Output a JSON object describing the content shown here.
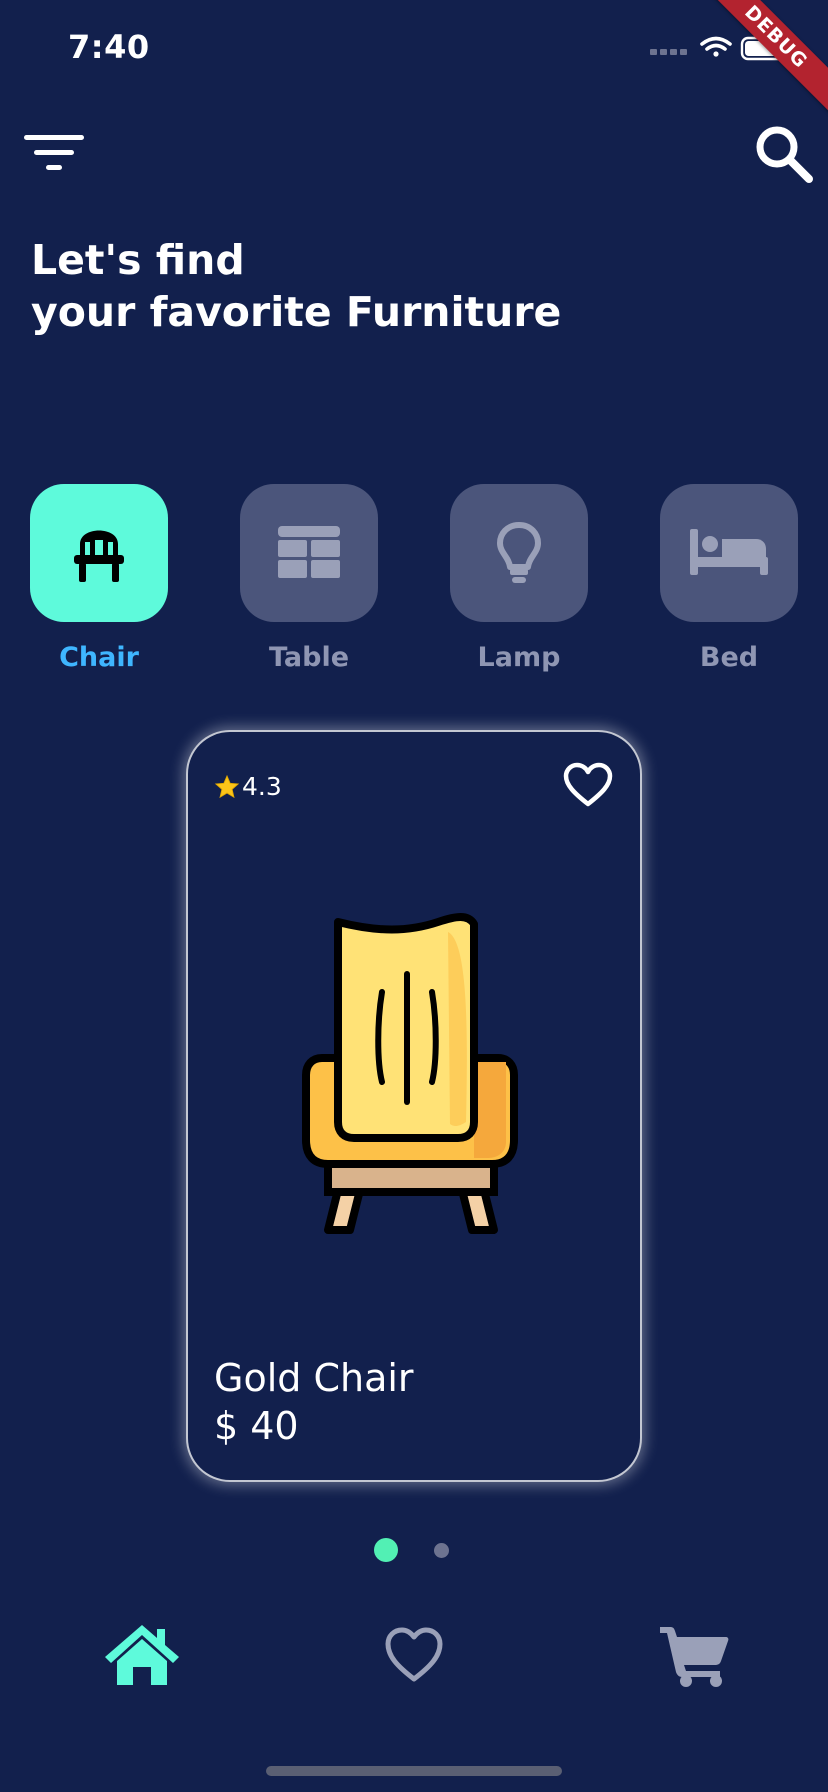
{
  "status_bar": {
    "time": "7:40",
    "debug_label": "DEBUG"
  },
  "header": {
    "menu_icon": "filter-icon",
    "search_icon": "search-icon",
    "headline_line1": "Let's find",
    "headline_line2": "your favorite Furniture"
  },
  "categories": [
    {
      "label": "Chair",
      "icon": "chair-icon",
      "active": true
    },
    {
      "label": "Table",
      "icon": "table-icon",
      "active": false
    },
    {
      "label": "Lamp",
      "icon": "lamp-icon",
      "active": false
    },
    {
      "label": "Bed",
      "icon": "bed-icon",
      "active": false
    }
  ],
  "product": {
    "rating": "4.3",
    "name": "Gold Chair",
    "price": "$ 40",
    "favorite_icon": "heart-outline-icon"
  },
  "carousel": {
    "page_count": 2,
    "active_index": 0
  },
  "bottom_nav": [
    {
      "name": "home",
      "icon": "home-icon",
      "active": true
    },
    {
      "name": "favorites",
      "icon": "heart-outline-icon",
      "active": false
    },
    {
      "name": "cart",
      "icon": "cart-icon",
      "active": false
    }
  ],
  "colors": {
    "background": "#12204d",
    "accent": "#5efadb",
    "active_label": "#3fb6ff",
    "inactive_tile": "#4b557b",
    "inactive_label": "#8f96b3",
    "active_dot": "#52f0b4",
    "inactive_dot": "#6d7390",
    "debug_banner": "#b3232f"
  }
}
